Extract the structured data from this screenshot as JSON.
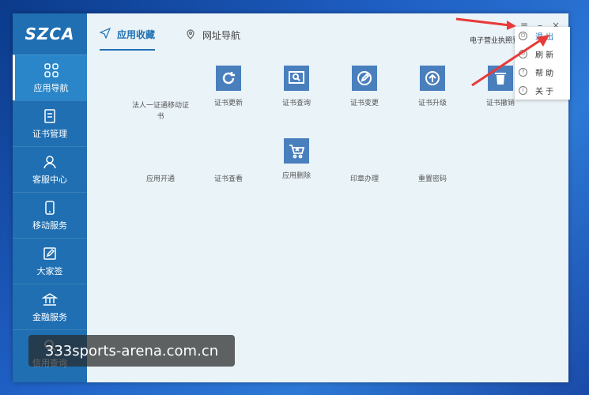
{
  "app": {
    "logo": "SZCA"
  },
  "sidebar": {
    "items": [
      {
        "label": "应用导航",
        "icon": "grid-icon",
        "active": true
      },
      {
        "label": "证书管理",
        "icon": "document-icon"
      },
      {
        "label": "客服中心",
        "icon": "user-icon"
      },
      {
        "label": "移动服务",
        "icon": "phone-icon"
      },
      {
        "label": "大家签",
        "icon": "edit-icon"
      },
      {
        "label": "金融服务",
        "icon": "bank-icon"
      },
      {
        "label": "信用查询",
        "icon": "search-icon"
      }
    ]
  },
  "tabs": [
    {
      "label": "应用收藏",
      "icon": "send-icon",
      "active": true
    },
    {
      "label": "网址导航",
      "icon": "location-icon"
    }
  ],
  "header": {
    "business_text": "电子营业执照登"
  },
  "window_controls": {
    "menu": "≡",
    "minimize": "–",
    "close": "×"
  },
  "apps_row1": [
    {
      "label": "法人一证通移动证书",
      "icon": ""
    },
    {
      "label": "证书更新",
      "icon": "refresh-icon"
    },
    {
      "label": "证书查询",
      "icon": "search-doc-icon"
    },
    {
      "label": "证书变更",
      "icon": "edit-icon"
    },
    {
      "label": "证书升级",
      "icon": "upgrade-icon"
    },
    {
      "label": "证书撤销",
      "icon": "trash-icon"
    }
  ],
  "apps_row2": [
    {
      "label": "应用开通",
      "icon": ""
    },
    {
      "label": "证书查看",
      "icon": ""
    },
    {
      "label": "应用删除",
      "icon": "cart-delete-icon"
    },
    {
      "label": "印章办理",
      "icon": ""
    },
    {
      "label": "重置密码",
      "icon": ""
    }
  ],
  "dropdown_menu": [
    {
      "label": "退 出",
      "highlighted": true
    },
    {
      "label": "刷 新"
    },
    {
      "label": "帮 助"
    },
    {
      "label": "关 于"
    }
  ],
  "watermark": "333sports-arena.com.cn",
  "colors": {
    "sidebar": "#1f6fb2",
    "accent": "#1f6fb2",
    "app_icon_bg": "#4a7fbe",
    "arrow": "#e83a3a"
  }
}
